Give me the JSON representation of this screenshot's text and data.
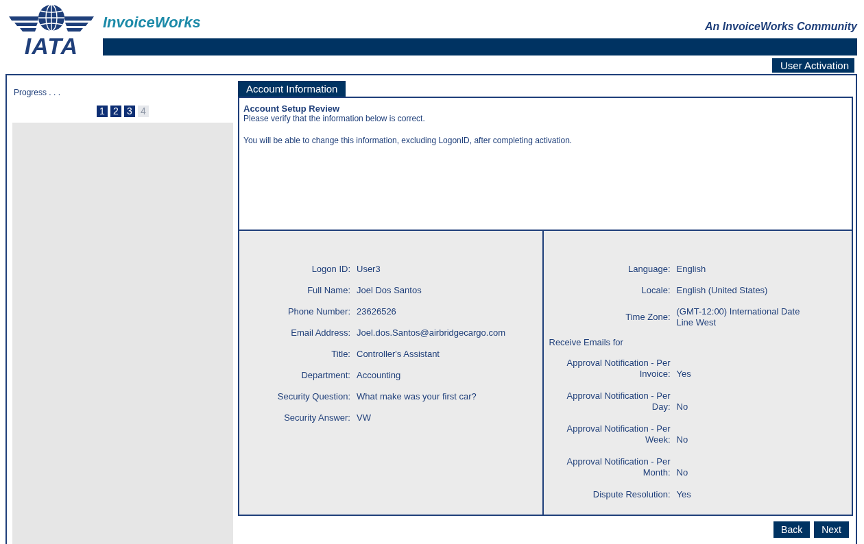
{
  "header": {
    "logo_text": "IATA",
    "brand": "InvoiceWorks",
    "community": "An InvoiceWorks Community",
    "page_tab": "User Activation"
  },
  "sidebar": {
    "title": "Progress . . .",
    "steps": [
      {
        "label": "1",
        "completed": true
      },
      {
        "label": "2",
        "completed": true
      },
      {
        "label": "3",
        "completed": true
      },
      {
        "label": "4",
        "completed": false
      }
    ]
  },
  "panel": {
    "tab": "Account Information",
    "heading": "Account Setup Review",
    "intro": "Please verify that the information below is correct.",
    "note": "You will be able to change this information, excluding LogonID, after completing activation."
  },
  "account_fields": [
    {
      "label": "Logon ID:",
      "value": "User3"
    },
    {
      "label": "Full Name:",
      "value": "Joel Dos Santos"
    },
    {
      "label": "Phone Number:",
      "value": "23626526"
    },
    {
      "label": "Email Address:",
      "value": "Joel.dos.Santos@airbridgecargo.com"
    },
    {
      "label": "Title:",
      "value": "Controller's Assistant"
    },
    {
      "label": "Department:",
      "value": "Accounting"
    },
    {
      "label": "Security Question:",
      "value": "What make was your first car?"
    },
    {
      "label": "Security Answer:",
      "value": "VW"
    }
  ],
  "preference_fields": [
    {
      "label": "Language:",
      "value": "English"
    },
    {
      "label": "Locale:",
      "value": "English (United States)"
    },
    {
      "label": "Time Zone:",
      "value": "(GMT-12:00) International Date Line West"
    }
  ],
  "emails_heading": "Receive Emails for",
  "email_fields": [
    {
      "label": "Approval Notification - Per Invoice:",
      "value": "Yes"
    },
    {
      "label": "Approval Notification - Per Day:",
      "value": "No"
    },
    {
      "label": "Approval Notification - Per Week:",
      "value": "No"
    },
    {
      "label": "Approval Notification - Per Month:",
      "value": "No"
    },
    {
      "label": "Dispute Resolution:",
      "value": "Yes"
    }
  ],
  "buttons": [
    "Back",
    "Next"
  ]
}
